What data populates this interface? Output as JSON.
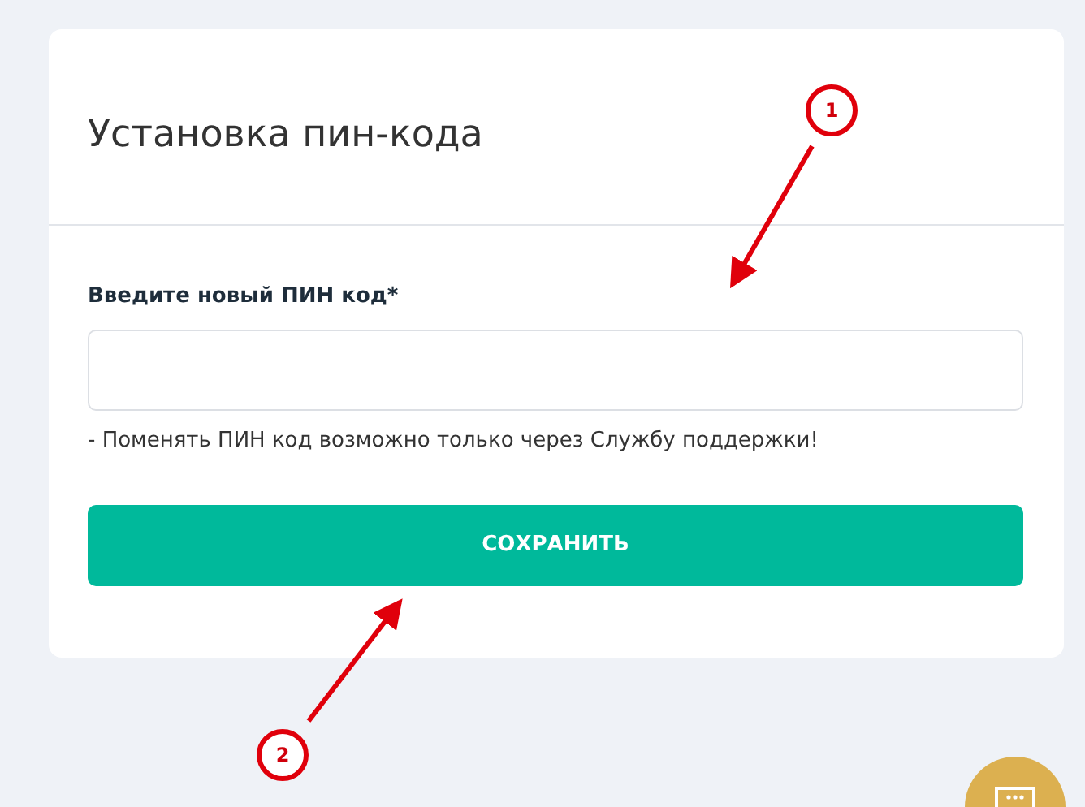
{
  "card": {
    "title": "Установка пин-кода"
  },
  "form": {
    "label": "Введите новый ПИН код*",
    "hint": "- Поменять ПИН код возможно только через Службу поддержки!",
    "button": "СОХРАНИТЬ"
  },
  "annotations": [
    {
      "number": "1"
    },
    {
      "number": "2"
    }
  ]
}
